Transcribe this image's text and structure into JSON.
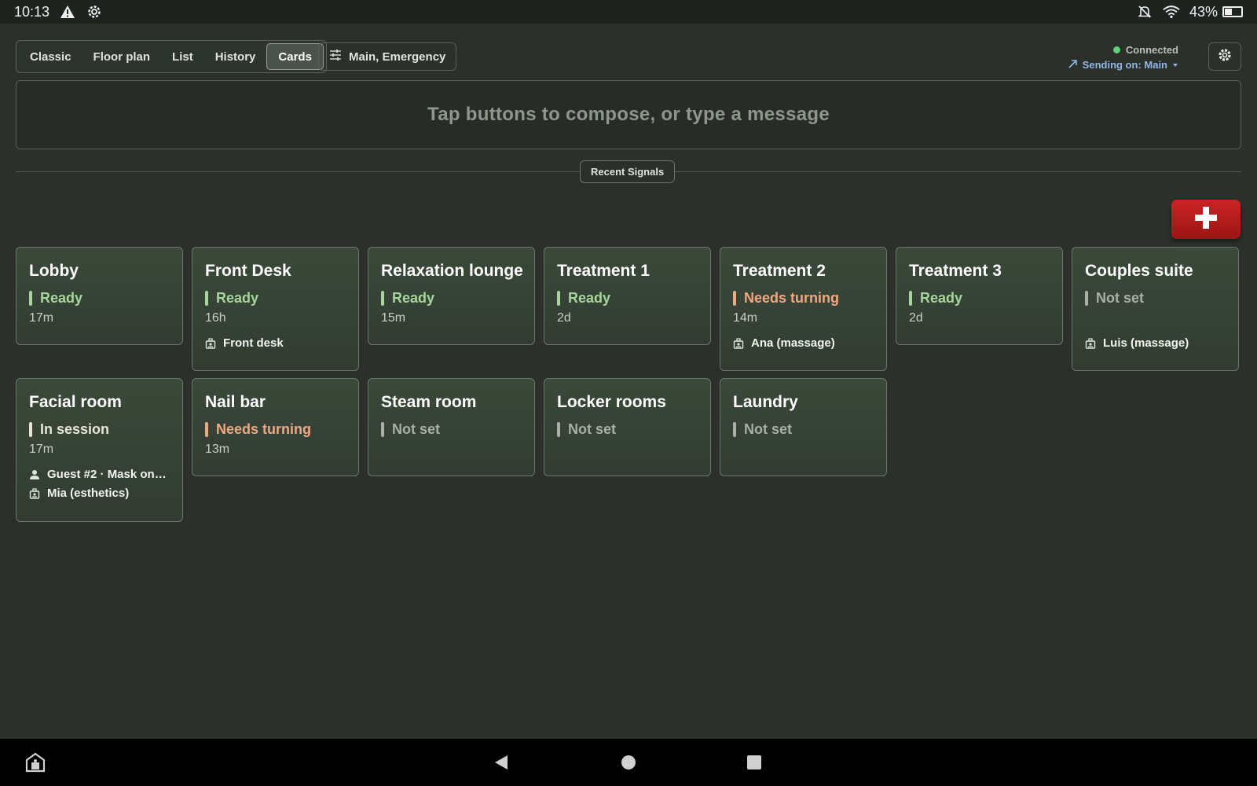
{
  "status_bar": {
    "time": "10:13",
    "battery": "43%",
    "battery_level": 0.43,
    "icons": [
      "warning-icon",
      "settings-gear-icon",
      "notifications-off-icon",
      "wifi-icon",
      "battery-charging-icon"
    ]
  },
  "view_tabs": [
    {
      "label": "Classic",
      "active": false
    },
    {
      "label": "Floor plan",
      "active": false
    },
    {
      "label": "List",
      "active": false
    },
    {
      "label": "History",
      "active": false
    },
    {
      "label": "Cards",
      "active": true
    }
  ],
  "filter": {
    "label": "Main, Emergency",
    "icon": "sliders-icon"
  },
  "connection": {
    "status": "Connected",
    "sending": "Sending on: Main",
    "status_color": "#5fcf7c"
  },
  "compose": {
    "placeholder": "Tap buttons to compose, or type a message"
  },
  "recent_signals_label": "Recent Signals",
  "emergency": {
    "icon": "plus-icon",
    "color": "#c01d1d"
  },
  "status_colors": {
    "Ready": "#a5d69a",
    "Needs turning": "#f0a883",
    "In session": "#e8e4d8",
    "Not set": "#a9b0a7"
  },
  "rooms": [
    {
      "name": "Lobby",
      "status": "Ready",
      "time": "17m",
      "meta": []
    },
    {
      "name": "Front Desk",
      "status": "Ready",
      "time": "16h",
      "meta": [
        {
          "icon": "staff-icon",
          "text": "Front desk"
        }
      ]
    },
    {
      "name": "Relaxation lounge",
      "status": "Ready",
      "time": "15m",
      "meta": []
    },
    {
      "name": "Treatment 1",
      "status": "Ready",
      "time": "2d",
      "meta": []
    },
    {
      "name": "Treatment 2",
      "status": "Needs turning",
      "time": "14m",
      "meta": [
        {
          "icon": "staff-icon",
          "text": "Ana (massage)"
        }
      ]
    },
    {
      "name": "Treatment 3",
      "status": "Ready",
      "time": "2d",
      "meta": []
    },
    {
      "name": "Couples suite",
      "status": "Not set",
      "time": "",
      "meta": [
        {
          "icon": "staff-icon",
          "text": "Luis (massage)"
        }
      ]
    },
    {
      "name": "Facial room",
      "status": "In session",
      "time": "17m",
      "meta": [
        {
          "icon": "person-icon",
          "text": "Guest #2 · Mask on…"
        },
        {
          "icon": "staff-icon",
          "text": "Mia (esthetics)"
        }
      ]
    },
    {
      "name": "Nail bar",
      "status": "Needs turning",
      "time": "13m",
      "meta": []
    },
    {
      "name": "Steam room",
      "status": "Not set",
      "time": "",
      "meta": []
    },
    {
      "name": "Locker rooms",
      "status": "Not set",
      "time": "",
      "meta": []
    },
    {
      "name": "Laundry",
      "status": "Not set",
      "time": "",
      "meta": []
    }
  ],
  "nav_bar": {
    "icons": [
      "app-switcher-icon",
      "back-icon",
      "home-icon",
      "recents-icon"
    ]
  }
}
